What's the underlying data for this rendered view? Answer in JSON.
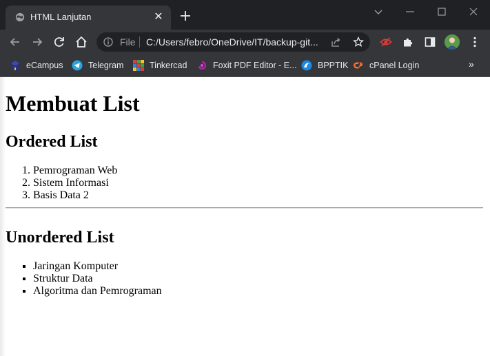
{
  "window": {
    "tab_title": "HTML Lanjutan",
    "tab_close": "✕"
  },
  "toolbar": {
    "scheme_label": "File",
    "url": "C:/Users/febro/OneDrive/IT/backup-git..."
  },
  "bookmarks": [
    {
      "label": "eCampus",
      "icon": "ecampus-icon"
    },
    {
      "label": "Telegram",
      "icon": "telegram-icon"
    },
    {
      "label": "Tinkercad",
      "icon": "tinkercad-icon"
    },
    {
      "label": "Foxit PDF Editor - E...",
      "icon": "foxit-icon"
    },
    {
      "label": "BPPTIK",
      "icon": "bpptik-icon"
    },
    {
      "label": "cPanel Login",
      "icon": "cpanel-icon"
    }
  ],
  "bookmarks_overflow": "»",
  "page": {
    "heading": "Membuat List",
    "ordered_heading": "Ordered List",
    "ordered_items": [
      "Pemrograman Web",
      "Sistem Informasi",
      "Basis Data 2"
    ],
    "unordered_heading": "Unordered List",
    "unordered_items": [
      "Jaringan Komputer",
      "Struktur Data",
      "Algoritma dan Pemrograman"
    ]
  },
  "colors": {
    "titlebar": "#202124",
    "toolbar": "#35363a",
    "text_light": "#e8eaed",
    "page_bg": "#ffffff"
  }
}
